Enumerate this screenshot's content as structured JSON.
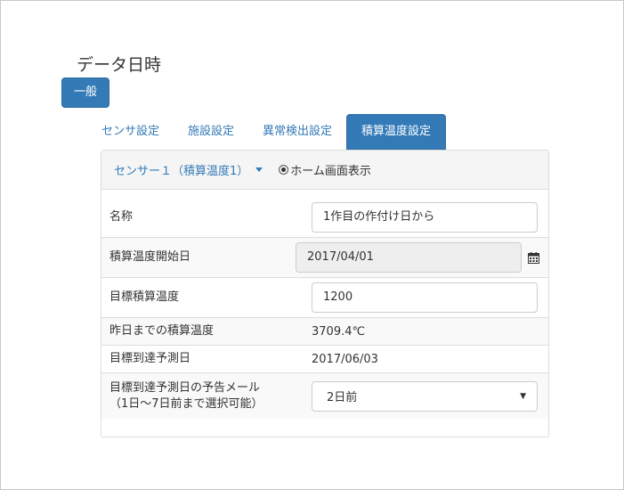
{
  "page": {
    "title": "データ日時",
    "primary_button": "一般"
  },
  "tabs": [
    {
      "label": "センサ設定",
      "active": false
    },
    {
      "label": "施設設定",
      "active": false
    },
    {
      "label": "異常検出設定",
      "active": false
    },
    {
      "label": "積算温度設定",
      "active": true
    }
  ],
  "panel": {
    "sensor_select": "センサー１（積算温度1）",
    "radio_label": "ホーム画面表示",
    "rows": {
      "name": {
        "label": "名称",
        "value": "1作目の作付け日から"
      },
      "start_date": {
        "label": "積算温度開始日",
        "value": "2017/04/01"
      },
      "target": {
        "label": "目標積算温度",
        "value": "1200"
      },
      "yesterday": {
        "label": "昨日までの積算温度",
        "value": "3709.4℃"
      },
      "forecast": {
        "label": "目標到達予測日",
        "value": "2017/06/03"
      },
      "mail": {
        "label_line1": "目標到達予測日の予告メール",
        "label_line2": "（1日～7日前まで選択可能）",
        "value": "2日前"
      }
    }
  },
  "colors": {
    "accent": "#337ab7",
    "border": "#dddddd"
  }
}
